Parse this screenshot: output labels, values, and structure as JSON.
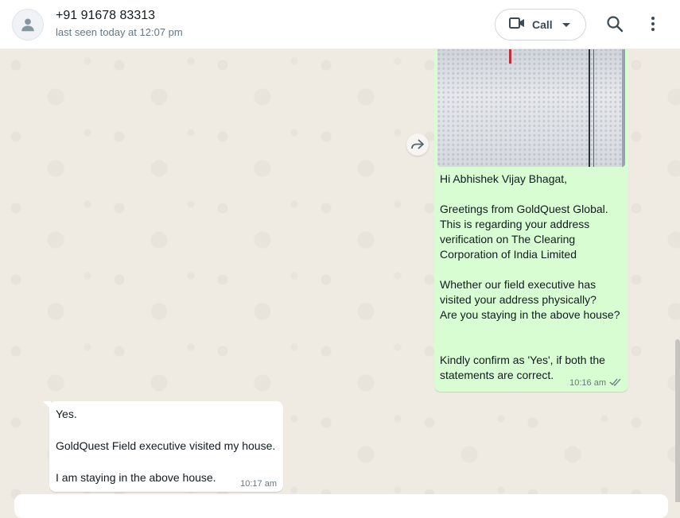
{
  "header": {
    "contact_name": "+91 91678 83313",
    "last_seen": "last seen today at 12:07 pm",
    "call_label": "Call",
    "icons": [
      "default-avatar-icon",
      "video-camera-icon",
      "chevron-down-icon",
      "search-icon",
      "kebab-menu-icon"
    ]
  },
  "messages": [
    {
      "direction": "outgoing",
      "has_image": true,
      "text": "Hi Abhishek Vijay Bhagat,\n\nGreetings from GoldQuest Global. This is regarding your address verification on The Clearing Corporation of India Limited\n\nWhether our field executive has visited your address physically?\nAre you staying in the above house?\n\n\nKindly confirm as 'Yes', if both the statements are correct.",
      "time": "10:16 am",
      "status_icon": "double-check-icon"
    },
    {
      "direction": "incoming",
      "text": "Yes.\n\nGoldQuest Field executive visited my house.\n\nI am staying in the above house.",
      "time": "10:17 am"
    }
  ],
  "colors": {
    "outgoing_bubble": "#d9fdd3",
    "incoming_bubble": "#ffffff",
    "chat_background": "#efeae2",
    "header_background": "#ffffff"
  }
}
